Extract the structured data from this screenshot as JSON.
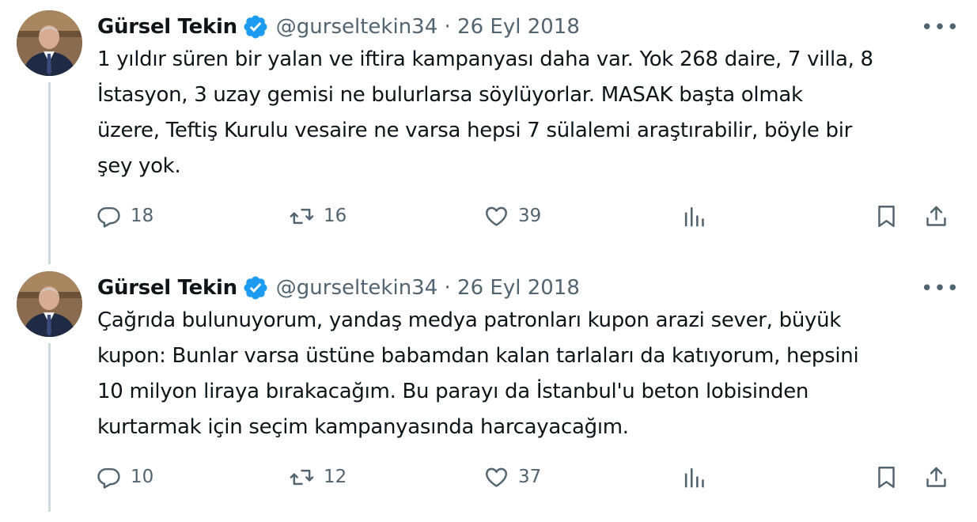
{
  "tweets": [
    {
      "author_name": "Gürsel Tekin",
      "handle_date": "@gurseltekin34 · 26 Eyl 2018",
      "more_label": "•••",
      "text": "1 yıldır süren bir yalan ve iftira kampanyası daha var. Yok 268 daire, 7 villa, 8\nİstasyon, 3 uzay gemisi ne bulurlarsa söylüyorlar. MASAK başta olmak\nüzere, Teftiş Kurulu vesaire ne varsa hepsi 7 sülalemi araştırabilir, böyle bir\nşey yok.",
      "replies": "18",
      "reposts": "16",
      "likes": "39"
    },
    {
      "author_name": "Gürsel Tekin",
      "handle_date": "@gurseltekin34 · 26 Eyl 2018",
      "more_label": "•••",
      "text": "Çağrıda bulunuyorum, yandaş medya patronları kupon arazi sever, büyük\nkupon: Bunlar varsa üstüne babamdan kalan tarlaları da katıyorum, hepsini\n10 milyon liraya bırakacağım. Bu parayı da İstanbul'u beton lobisinden\nkurtarmak için seçim kampanyasında harcayacağım.",
      "replies": "10",
      "reposts": "12",
      "likes": "37"
    }
  ],
  "icons": {
    "verified": "verified-badge-icon",
    "reply": "reply-icon",
    "repost": "repost-icon",
    "like": "like-icon",
    "views": "views-icon",
    "bookmark": "bookmark-icon",
    "share": "share-icon"
  },
  "colors": {
    "verified": "#1d9bf0",
    "secondary_text": "#536471",
    "thread_line": "#cfd9de"
  }
}
